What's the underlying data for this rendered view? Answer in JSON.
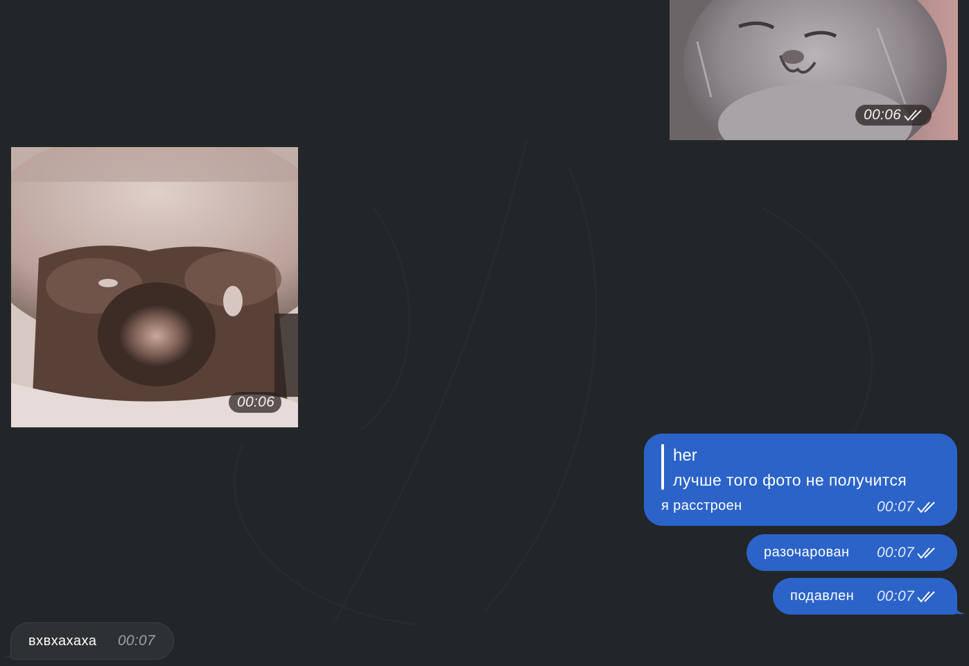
{
  "chat": {
    "messages": [
      {
        "type": "video",
        "direction": "outgoing",
        "time": "00:06",
        "status_icon": "double-check-icon"
      },
      {
        "type": "video",
        "direction": "incoming",
        "time": "00:06"
      },
      {
        "type": "text",
        "direction": "outgoing",
        "quote": {
          "author": "her",
          "text": "лучше того фото не получится"
        },
        "text": "я расстроен",
        "time": "00:07",
        "status_icon": "double-check-icon"
      },
      {
        "type": "text",
        "direction": "outgoing",
        "text": "разочарован",
        "time": "00:07",
        "status_icon": "double-check-icon"
      },
      {
        "type": "text",
        "direction": "outgoing",
        "text": "подавлен",
        "time": "00:07",
        "status_icon": "double-check-icon"
      },
      {
        "type": "text",
        "direction": "incoming",
        "text": "вхвхахаха",
        "time": "00:07"
      }
    ]
  },
  "colors": {
    "background": "#222629",
    "outgoing_bubble": "#2b63c9",
    "incoming_bubble": "#2d3134"
  }
}
